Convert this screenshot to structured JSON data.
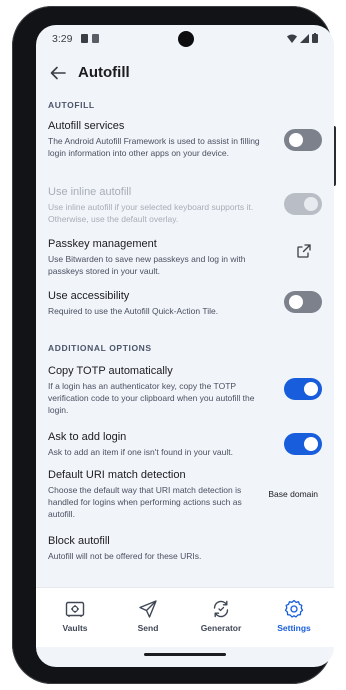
{
  "status": {
    "time": "3:29"
  },
  "header": {
    "title": "Autofill"
  },
  "sections": {
    "autofill": "AUTOFILL",
    "additional": "ADDITIONAL OPTIONS"
  },
  "items": {
    "autofill_services": {
      "title": "Autofill services",
      "desc": "The Android Autofill Framework is used to assist in filling login information into other apps on your device.",
      "enabled": false
    },
    "inline_autofill": {
      "title": "Use inline autofill",
      "desc": "Use inline autofill if your selected keyboard supports it. Otherwise, use the default overlay.",
      "enabled": true,
      "disabled": true
    },
    "passkey": {
      "title": "Passkey management",
      "desc": "Use Bitwarden to save new passkeys and log in with passkeys stored in your vault.",
      "icon": "external-link-icon"
    },
    "accessibility": {
      "title": "Use accessibility",
      "desc": "Required to use the Autofill Quick-Action Tile.",
      "enabled": false
    },
    "copy_totp": {
      "title": "Copy TOTP automatically",
      "desc": "If a login has an authenticator key, copy the TOTP verification code to your clipboard when you autofill the login.",
      "enabled": true
    },
    "ask_login": {
      "title": "Ask to add login",
      "desc": "Ask to add an item if one isn't found in your vault.",
      "enabled": true
    },
    "uri_match": {
      "title": "Default URI match detection",
      "desc": "Choose the default way that URI match detection is handled for logins when performing actions such as autofill.",
      "value": "Base domain"
    },
    "block_autofill": {
      "title": "Block autofill",
      "desc": "Autofill will not be offered for these URIs."
    }
  },
  "nav": {
    "vaults": "Vaults",
    "send": "Send",
    "generator": "Generator",
    "settings": "Settings",
    "active": "settings"
  },
  "colors": {
    "accent": "#175ddc",
    "background": "#f1f4f9",
    "toggle_off": "#7c818b"
  }
}
